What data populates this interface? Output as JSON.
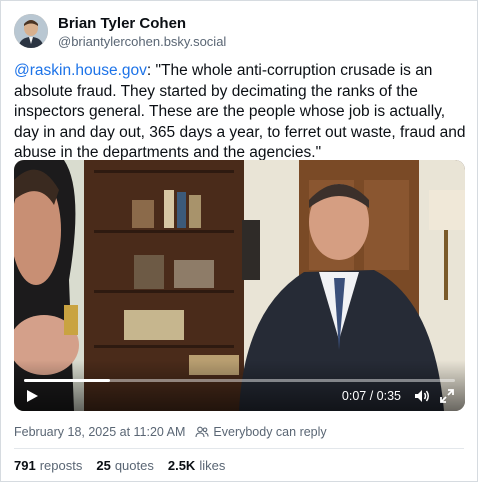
{
  "author": {
    "display_name": "Brian Tyler Cohen",
    "handle": "@briantylercohen.bsky.social"
  },
  "post": {
    "mention": "@raskin.house.gov",
    "text": ": \"The whole anti-corruption crusade is an absolute fraud. They started by decimating the ranks of the inspectors general. These are the people whose job is actually, day in and day out, 365 days a year, to ferret out waste, fraud and abuse in the departments and the agencies.\""
  },
  "video": {
    "time_display": "0:07 / 0:35",
    "progress_fraction": 0.2
  },
  "meta": {
    "timestamp": "February 18, 2025 at 11:20 AM",
    "reply_setting": "Everybody can reply"
  },
  "stats": {
    "reposts_count": "791",
    "reposts_label": "reposts",
    "quotes_count": "25",
    "quotes_label": "quotes",
    "likes_count": "2.5K",
    "likes_label": "likes"
  },
  "icons": {
    "play": "play-icon",
    "volume": "volume-icon",
    "fullscreen": "fullscreen-icon",
    "people": "people-icon"
  },
  "colors": {
    "mention": "#1d73e8",
    "text": "#0b0f14",
    "muted": "#5a6674"
  }
}
